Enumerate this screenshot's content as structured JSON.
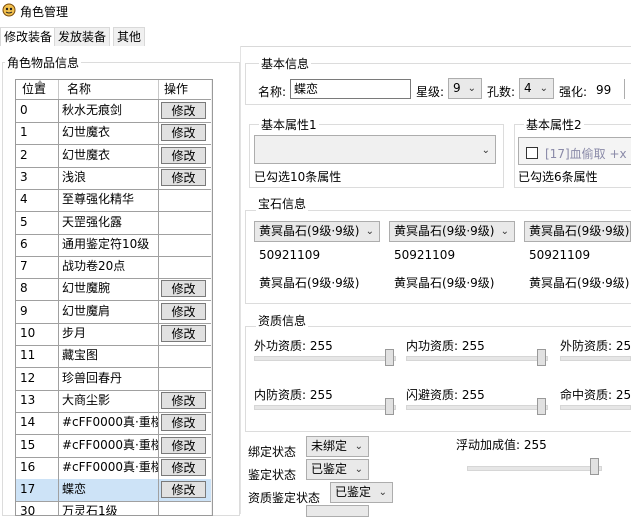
{
  "window": {
    "title": "角色管理"
  },
  "tabs": [
    {
      "label": "修改装备"
    },
    {
      "label": "发放装备"
    },
    {
      "label": "其他"
    }
  ],
  "items_panel": {
    "title": "角色物品信息",
    "columns": [
      "位置",
      "名称",
      "操作"
    ],
    "rows": [
      {
        "idx": "0",
        "name": "秋水无痕剑",
        "op": "修改"
      },
      {
        "idx": "1",
        "name": "幻世魔衣",
        "op": "修改"
      },
      {
        "idx": "2",
        "name": "幻世魔衣",
        "op": "修改"
      },
      {
        "idx": "3",
        "name": "浅浪",
        "op": "修改"
      },
      {
        "idx": "4",
        "name": "至尊强化精华",
        "op": ""
      },
      {
        "idx": "5",
        "name": "天罡强化露",
        "op": ""
      },
      {
        "idx": "6",
        "name": "通用鉴定符10级",
        "op": ""
      },
      {
        "idx": "7",
        "name": "战功卷20点",
        "op": ""
      },
      {
        "idx": "8",
        "name": "幻世魔腕",
        "op": "修改"
      },
      {
        "idx": "9",
        "name": "幻世魔肩",
        "op": "修改"
      },
      {
        "idx": "10",
        "name": "步月",
        "op": "修改"
      },
      {
        "idx": "11",
        "name": "藏宝图",
        "op": ""
      },
      {
        "idx": "12",
        "name": "珍兽回春丹",
        "op": ""
      },
      {
        "idx": "13",
        "name": "大商尘影",
        "op": "修改"
      },
      {
        "idx": "14",
        "name": "#cFF0000真·重楼",
        "op": "修改"
      },
      {
        "idx": "15",
        "name": "#cFF0000真·重楼",
        "op": "修改"
      },
      {
        "idx": "16",
        "name": "#cFF0000真·重楼",
        "op": "修改"
      },
      {
        "idx": "17",
        "name": "蝶恋",
        "op": "修改"
      },
      {
        "idx": "30",
        "name": "万灵石1级",
        "op": ""
      }
    ],
    "selected_index": 17
  },
  "basic": {
    "title": "基本信息",
    "name_label": "名称:",
    "name_value": "蝶恋",
    "star_label": "星级:",
    "star_value": "9",
    "holes_label": "孔数:",
    "holes_value": "4",
    "enhance_label": "强化:",
    "enhance_value": "99"
  },
  "attr1": {
    "title": "基本属性1",
    "status": "已勾选10条属性"
  },
  "attr2": {
    "title": "基本属性2",
    "item": "[17]血偷取 +x",
    "status": "已勾选6条属性"
  },
  "gems": {
    "title": "宝石信息",
    "slots": [
      {
        "select": "黄冥晶石(9级·9级)",
        "id": "50921109",
        "name": "黄冥晶石(9级·9级)"
      },
      {
        "select": "黄冥晶石(9级·9级)",
        "id": "50921109",
        "name": "黄冥晶石(9级·9级)"
      },
      {
        "select": "黄冥晶石(9级·9级)",
        "id": "50921109",
        "name": "黄冥晶石(9级·9级)"
      }
    ]
  },
  "aptitude": {
    "title": "资质信息",
    "items": [
      {
        "label": "外功资质: 255",
        "value": 255
      },
      {
        "label": "内功资质: 255",
        "value": 255
      },
      {
        "label": "外防资质: 255",
        "value": 255
      },
      {
        "label": "内防资质: 255",
        "value": 255
      },
      {
        "label": "闪避资质: 255",
        "value": 255
      },
      {
        "label": "命中资质: 255",
        "value": 255
      }
    ]
  },
  "status": {
    "bind_label": "绑定状态",
    "bind_value": "未绑定",
    "identify_label": "鉴定状态",
    "identify_value": "已鉴定",
    "apt_identify_label": "资质鉴定状态",
    "apt_identify_value": "已鉴定",
    "float_label": "浮动加成值: 255",
    "float_value": 255
  }
}
